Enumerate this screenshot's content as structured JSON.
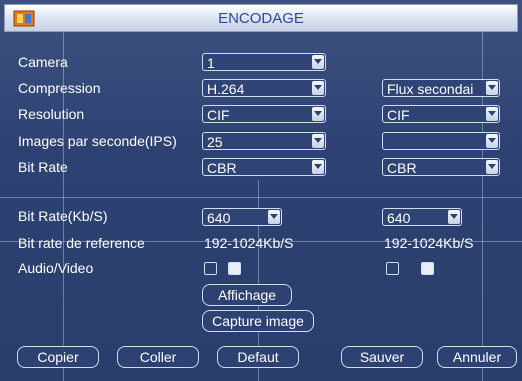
{
  "window": {
    "title": "ENCODAGE"
  },
  "labels": {
    "camera": "Camera",
    "compression": "Compression",
    "resolution": "Resolution",
    "fps": "Images par seconde(IPS)",
    "bitrate_type": "Bit Rate",
    "bitrate_kbs": "Bit Rate(Kb/S)",
    "bitrate_ref": "Bit rate de reference",
    "audio_video": "Audio/Video"
  },
  "main": {
    "camera": "1",
    "compression": "H.264",
    "resolution": "CIF",
    "fps": "25",
    "bitrate_type": "CBR",
    "bitrate_kbs": "640",
    "bitrate_ref": "192-1024Kb/S"
  },
  "sub": {
    "stream": "Flux secondai",
    "resolution": "CIF",
    "fps": "",
    "bitrate_type": "CBR",
    "bitrate_kbs": "640",
    "bitrate_ref": "192-1024Kb/S"
  },
  "buttons": {
    "affichage": "Affichage",
    "capture": "Capture image",
    "copier": "Copier",
    "coller": "Coller",
    "defaut": "Defaut",
    "sauver": "Sauver",
    "annuler": "Annuler"
  },
  "colors": {
    "accent": "#2c4aa0",
    "background": "#2d4273"
  }
}
